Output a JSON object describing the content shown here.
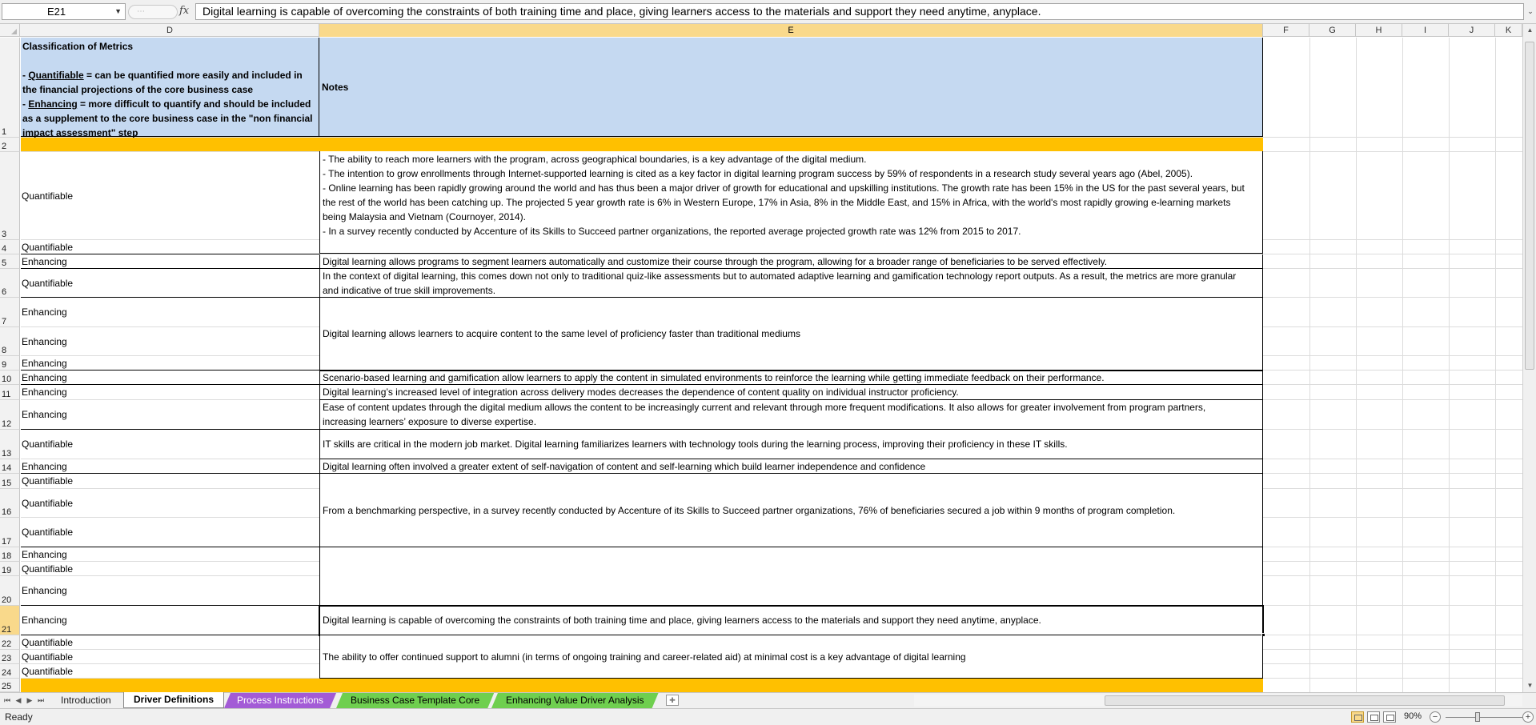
{
  "formula_bar": {
    "name_box": "E21",
    "fx_symbol": "fx",
    "formula": "Digital learning is capable of overcoming the constraints of both training time and place, giving learners access to the materials and support they need anytime, anyplace."
  },
  "columns": [
    "D",
    "E",
    "F",
    "G",
    "H",
    "I",
    "J",
    "K"
  ],
  "rows": [
    "1",
    "2",
    "3",
    "4",
    "5",
    "6",
    "7",
    "8",
    "9",
    "10",
    "11",
    "12",
    "13",
    "14",
    "15",
    "16",
    "17",
    "18",
    "19",
    "20",
    "21",
    "22",
    "23",
    "24",
    "25"
  ],
  "header": {
    "title": "Classification of Metrics",
    "q_term": "Quantifiable",
    "q_desc": " = can be quantified more easily and included in the financial projections of the core business case",
    "e_term": "Enhancing",
    "e_desc": " = more difficult to quantify and should be included as a supplement to the core business case in the \"non financial impact assessment\" step",
    "dash": "- ",
    "notes": "Notes"
  },
  "classifications": {
    "r3": "Quantifiable",
    "r4": "Quantifiable",
    "r5": "Enhancing",
    "r6": "Quantifiable",
    "r7": "Enhancing",
    "r8": "Enhancing",
    "r9": "Enhancing",
    "r10": "Enhancing",
    "r11": "Enhancing",
    "r12": "Enhancing",
    "r13": "Quantifiable",
    "r14": "Enhancing",
    "r15": "Quantifiable",
    "r16": "Quantifiable",
    "r17": "Quantifiable",
    "r18": "Enhancing",
    "r19": "Quantifiable",
    "r20": "Enhancing",
    "r21": "Enhancing",
    "r22": "Quantifiable",
    "r23": "Quantifiable",
    "r24": "Quantifiable"
  },
  "notes": {
    "n3a": "- The ability to reach more learners with the program, across geographical boundaries, is a key advantage of the digital medium.",
    "n3b": "- The intention to grow enrollments through Internet-supported learning is cited as a key factor in digital learning program success by 59% of respondents in a research study several years ago (Abel, 2005).",
    "n3c": "- Online learning has been rapidly growing around the world and has thus been a major driver of growth for educational and upskilling institutions. The growth rate has been 15% in the US for the past several years, but the rest of the world has been catching up. The projected 5 year growth rate is 6% in Western Europe, 17% in Asia, 8% in the Middle East, and 15% in Africa, with the world's most rapidly growing e-learning markets being Malaysia and Vietnam (Cournoyer, 2014).",
    "n3d": "- In a survey recently conducted by Accenture of its Skills to Succeed partner organizations, the reported average projected growth rate was 12% from 2015 to 2017.",
    "n5": "Digital learning allows programs to segment learners automatically and customize their course through the program, allowing for a broader range of beneficiaries to be served effectively.",
    "n6": "In the context of digital learning, this comes down not only to traditional quiz-like assessments but to automated adaptive learning and gamification technology report outputs. As a result, the metrics are more granular and indicative of true skill improvements.",
    "n7": "Digital learning allows learners to acquire content to the same level of proficiency faster than traditional mediums",
    "n10": "Scenario-based learning and gamification allow learners to apply the content in simulated environments to reinforce the learning while getting immediate feedback on their performance.",
    "n11": "Digital learning’s increased level of integration across delivery modes decreases the dependence  of content quality on individual instructor proficiency.",
    "n12": "Ease of content updates through the digital medium allows the content to be increasingly current and relevant through more frequent modifications. It also allows for greater involvement from program partners, increasing learners’ exposure to diverse expertise.",
    "n13": "IT skills are critical in the modern job market. Digital learning familiarizes learners with technology tools during the learning process, improving their proficiency in these IT skills.",
    "n14": "Digital learning often involved a greater extent of self-navigation of content and self-learning which build learner independence and confidence",
    "n15": "From a benchmarking perspective, in a survey recently conducted by Accenture of its Skills to Succeed partner organizations, 76% of beneficiaries secured a job within 9 months of program completion.",
    "n21": "Digital learning is capable of overcoming the constraints of both training time and place, giving learners access to the materials and support they need anytime, anyplace.",
    "n22": "The ability to offer continued support to alumni (in terms of ongoing training and career-related aid) at minimal cost is a key advantage of digital learning"
  },
  "sheet_tabs": [
    "Introduction",
    "Driver Definitions",
    "Process Instructions",
    "Business Case Template Core",
    "Enhancing Value Driver Analysis"
  ],
  "active_tab": "Driver Definitions",
  "status": {
    "ready": "Ready",
    "zoom": "90%"
  },
  "colors": {
    "header_fill": "#c5d9f1",
    "band_fill": "#ffc000",
    "tab_purple": "#a35bd6",
    "tab_green": "#6fcf4f",
    "selection_highlight": "#f9d98b"
  }
}
